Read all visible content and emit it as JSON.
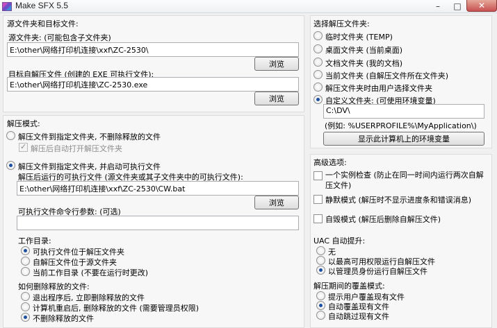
{
  "window": {
    "title": "Make SFX 5.5",
    "minimize": "–",
    "maximize": "□",
    "close": "✕"
  },
  "source": {
    "title": "源文件夹和目标文件:",
    "folder_label": "源文件夹: (可能包含子文件夹)",
    "folder_value": "E:\\other\\网络打印机连接\\xxf\\ZC-2530\\",
    "browse_label": "浏览",
    "target_label": "目标自解压文件 (创建的 EXE 可执行文件):",
    "target_value": "E:\\other\\网络打印机连接\\ZC-2530.exe"
  },
  "mode": {
    "title": "解压模式:",
    "option1": "解压文件到指定文件夹, 不删除释放的文件",
    "open_after": "解压后自动打开解压文件夹",
    "option2": "解压文件到指定文件夹, 并启动可执行文件",
    "exe_label": "解压后运行的可执行文件 (源文件夹或其子文件夹中的可执行文件):",
    "exe_value": "E:\\other\\网络打印机连接\\xxf\\ZC-2530\\CW.bat",
    "browse_label": "浏览",
    "args_label": "可执行文件命令行参数: (可选)",
    "args_value": "",
    "workdir_title": "工作目录:",
    "workdir_options": [
      "可执行文件位于解压文件夹",
      "自解压文件位于源文件夹",
      "当前工作目录 (不要在运行时更改)"
    ],
    "delete_title": "如何删除释放的文件:",
    "delete_options": [
      "退出程序后, 立即删除释放的文件",
      "计算机重启后, 删除释放的文件 (需要管理员权限)",
      "不删除释放的文件"
    ]
  },
  "extract": {
    "title": "选择解压文件夹:",
    "options": [
      "临时文件夹 (TEMP)",
      "桌面文件夹 (当前桌面)",
      "文档文件夹 (我的文档)",
      "当前文件夹 (自解压文件所在文件夹)",
      "解压文件夹时由用户选择文件夹",
      "自定义文件夹: (可使用环境变量)"
    ],
    "custom_value": "C:\\DV\\",
    "example": "(例如: %USERPROFILE%\\MyApplication\\)",
    "env_button": "显示此计算机上的环境变量"
  },
  "advanced": {
    "title": "高级选项:",
    "single_instance_1": "一个实例检查 (防止在同一时间内运行两次自解",
    "single_instance_2": "压文件)",
    "silent": "静默模式 (解压时不显示进度条和错误消息)",
    "self_destruct": "自毁模式 (解压后删除自解压文件)",
    "uac_title": "UAC 自动提升:",
    "uac_options": [
      "无",
      "以最高可用权限运行自解压文件",
      "以管理员身份运行自解压文件"
    ],
    "overwrite_title": "解压期间的覆盖模式:",
    "overwrite_options": [
      "提示用户覆盖现有文件",
      "自动覆盖现有文件",
      "自动跳过现有文件"
    ]
  }
}
